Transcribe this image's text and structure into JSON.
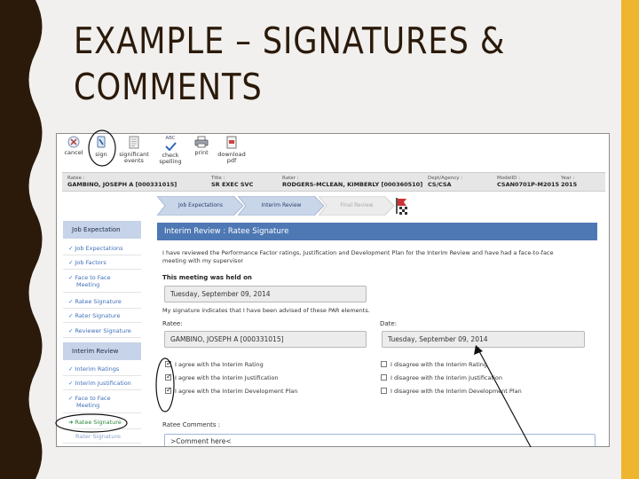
{
  "slide": {
    "title_line1": "EXAMPLE – SIGNATURES &",
    "title_line2": "COMMENTS",
    "colors": {
      "accent_bar": "#eeb52e",
      "wave": "#2b1a0a",
      "background": "#f1f0ee"
    }
  },
  "toolbar": {
    "cancel": "cancel",
    "sign": "sign",
    "significant_line1": "significant",
    "significant_line2": "events",
    "check_icon_text": "ABC",
    "check_line1": "check",
    "check_line2": "spelling",
    "print": "print",
    "download_line1": "download",
    "download_line2": "pdf"
  },
  "info": {
    "ratee_label": "Ratee :",
    "ratee_value": "GAMBINO, JOSEPH A [000331015]",
    "title_label": "Title :",
    "title_value": "SR EXEC SVC",
    "rater_label": "Rater :",
    "rater_value": "RODGERS-MCLEAN, KIMBERLY [000360510]",
    "dept_label": "Dept/Agency :",
    "dept_value": "CS/CSA",
    "model_label": "ModelID :",
    "model_value": "CSAN0701P-M2015",
    "year_label": "Year :",
    "year_value": "2015"
  },
  "breadcrumb": {
    "step1": "Job Expectations",
    "step2": "Interim Review",
    "step3": "Final Review"
  },
  "sidenav": {
    "section1_title": "Job Expectation",
    "section1_items": [
      "Job Expectations",
      "Job Factors",
      "Face to Face",
      "Meeting",
      "Ratee Signature",
      "Rater Signature",
      "Reviewer Signature"
    ],
    "section2_title": "Interim Review",
    "section2_items": [
      "Interim Ratings",
      "Interim Justification",
      "Face to Face",
      "Meeting",
      "Ratee Signature",
      "Rater Signature"
    ]
  },
  "panel": {
    "title": "Interim Review : Ratee Signature",
    "intro_line1": "I have reviewed the Performance Factor ratings, Justification and Development Plan for the Interim Review and have had a face-to-face",
    "intro_line2": "meeting with my supervisor",
    "meeting_label": "This meeting was held on",
    "meeting_date": "Tuesday, September 09, 2014",
    "advised_text": "My signature indicates that I have been advised of these PAR elements.",
    "ratee_label": "Ratee:",
    "ratee_value": "GAMBINO, JOSEPH A [000331015]",
    "date_label": "Date:",
    "date_value": "Tuesday, September 09, 2014",
    "agree_options": [
      "I agree with the Interim Rating",
      "I agree with the Interim Justification",
      "I agree with the Interim Development Plan"
    ],
    "disagree_options": [
      "I disagree with the Interim Rating",
      "I disagree with the Interim Justification",
      "I disagree with the Interim Development Plan"
    ],
    "comments_label": "Ratee Comments :",
    "comments_value": ">Comment here<"
  }
}
